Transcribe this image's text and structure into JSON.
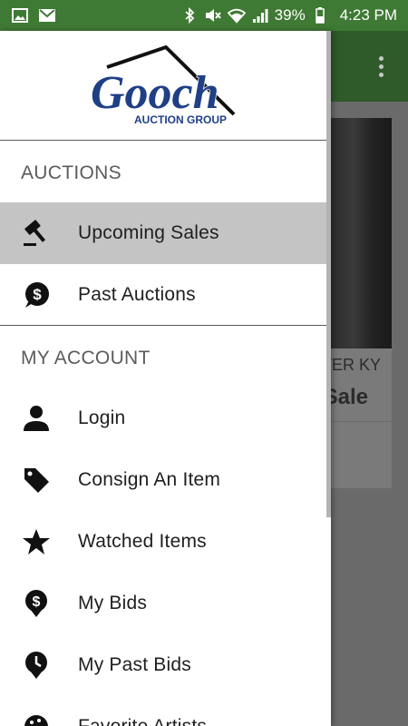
{
  "status_bar": {
    "battery": "39%",
    "time": "4:23 PM"
  },
  "logo": {
    "brand": "Gooch",
    "sub": "AUCTION GROUP"
  },
  "sections": {
    "auctions": "AUCTIONS",
    "account": "MY ACCOUNT"
  },
  "nav": {
    "upcoming_sales": "Upcoming Sales",
    "past_auctions": "Past Auctions",
    "login": "Login",
    "consign": "Consign An Item",
    "watched": "Watched Items",
    "my_bids": "My Bids",
    "my_past_bids": "My Past Bids",
    "favorite_artists": "Favorite Artists"
  },
  "background": {
    "card_location": "TER KY",
    "card_title": "Sale"
  },
  "colors": {
    "status_bar": "#3f7a34",
    "logo_blue": "#1f3f86",
    "active_item": "#c4c4c4"
  }
}
